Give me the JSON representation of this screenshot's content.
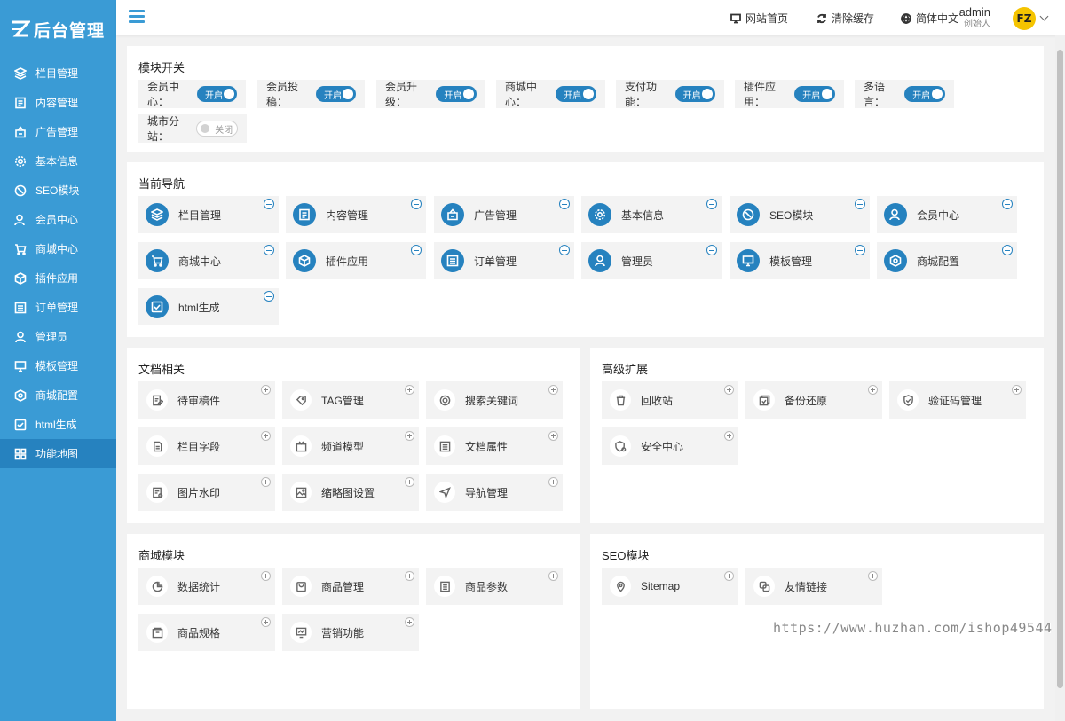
{
  "app": {
    "logo_text": "后台管理"
  },
  "sidebar": {
    "items": [
      {
        "label": "栏目管理",
        "icon": "layers-icon"
      },
      {
        "label": "内容管理",
        "icon": "document-icon"
      },
      {
        "label": "广告管理",
        "icon": "ad-icon"
      },
      {
        "label": "基本信息",
        "icon": "gear-icon"
      },
      {
        "label": "SEO模块",
        "icon": "seo-icon"
      },
      {
        "label": "会员中心",
        "icon": "user-icon"
      },
      {
        "label": "商城中心",
        "icon": "cart-icon"
      },
      {
        "label": "插件应用",
        "icon": "cube-icon"
      },
      {
        "label": "订单管理",
        "icon": "list-icon"
      },
      {
        "label": "管理员",
        "icon": "admin-icon"
      },
      {
        "label": "模板管理",
        "icon": "monitor-icon"
      },
      {
        "label": "商城配置",
        "icon": "config-icon"
      },
      {
        "label": "html生成",
        "icon": "check-square-icon"
      },
      {
        "label": "功能地图",
        "icon": "grid-icon"
      }
    ],
    "active_index": 13
  },
  "header": {
    "site_home": "网站首页",
    "clear_cache": "清除缓存",
    "language": "简体中文",
    "user_name": "admin",
    "user_role": "创始人",
    "avatar_text": "FZ"
  },
  "module_switch": {
    "title": "模块开关",
    "toggles": [
      {
        "label": "会员中心：",
        "state": "开启"
      },
      {
        "label": "会员投稿：",
        "state": "开启"
      },
      {
        "label": "会员升级：",
        "state": "开启"
      },
      {
        "label": "商城中心：",
        "state": "开启"
      },
      {
        "label": "支付功能：",
        "state": "开启"
      },
      {
        "label": "插件应用：",
        "state": "开启"
      },
      {
        "label": "多语言：",
        "state": "开启"
      },
      {
        "label": "城市分站：",
        "state": "关闭"
      }
    ]
  },
  "current_nav": {
    "title": "当前导航",
    "items": [
      "栏目管理",
      "内容管理",
      "广告管理",
      "基本信息",
      "SEO模块",
      "会员中心",
      "商城中心",
      "插件应用",
      "订单管理",
      "管理员",
      "模板管理",
      "商城配置",
      "html生成"
    ]
  },
  "doc_related": {
    "title": "文档相关",
    "items": [
      "待审稿件",
      "TAG管理",
      "搜索关键词",
      "栏目字段",
      "频道模型",
      "文档属性",
      "图片水印",
      "缩略图设置",
      "导航管理"
    ]
  },
  "advanced": {
    "title": "高级扩展",
    "items": [
      "回收站",
      "备份还原",
      "验证码管理",
      "安全中心"
    ]
  },
  "shop_module": {
    "title": "商城模块",
    "items": [
      "数据统计",
      "商品管理",
      "商品参数",
      "商品规格",
      "营销功能"
    ]
  },
  "seo_module": {
    "title": "SEO模块",
    "items": [
      "Sitemap",
      "友情链接"
    ]
  },
  "watermark": "https://www.huzhan.com/ishop49544",
  "colors": {
    "sidebar": "#3a9bd5",
    "accent": "#2682bf",
    "avatar": "#f5c400"
  }
}
